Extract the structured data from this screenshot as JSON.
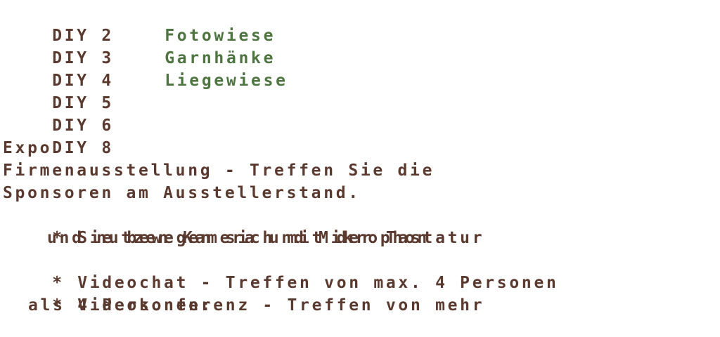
{
  "rooms": [
    {
      "code": "DIY 2",
      "name": "Fotowiese"
    },
    {
      "code": "DIY 3",
      "name": "Garnhänke"
    },
    {
      "code": "DIY 4",
      "name": "Liegewiese"
    },
    {
      "code": "DIY 5",
      "name": ""
    },
    {
      "code": "DIY 6",
      "name": ""
    },
    {
      "code": "DIY 8",
      "name": ""
    }
  ],
  "expo": {
    "title": "Expo",
    "description_line1": "Firmenausstellung - Treffen Sie die",
    "description_line2": "Sponsoren am Ausstellerstand."
  },
  "bullets": {
    "marker": "*",
    "item1_line1": "Sie bewegen sich mit der Tastatur",
    "item1_line2": "und nutzen Kamera und Mikrophon",
    "item2_line1": "Videochat - Treffen von max. 4 Personen",
    "item3_line1": "Videokonferenz - Treffen von mehr",
    "item3_line2": "als 4 Personen:"
  },
  "colors": {
    "text": "#5a3a2e",
    "room_name": "#4e7440",
    "background": "#ffffff"
  }
}
